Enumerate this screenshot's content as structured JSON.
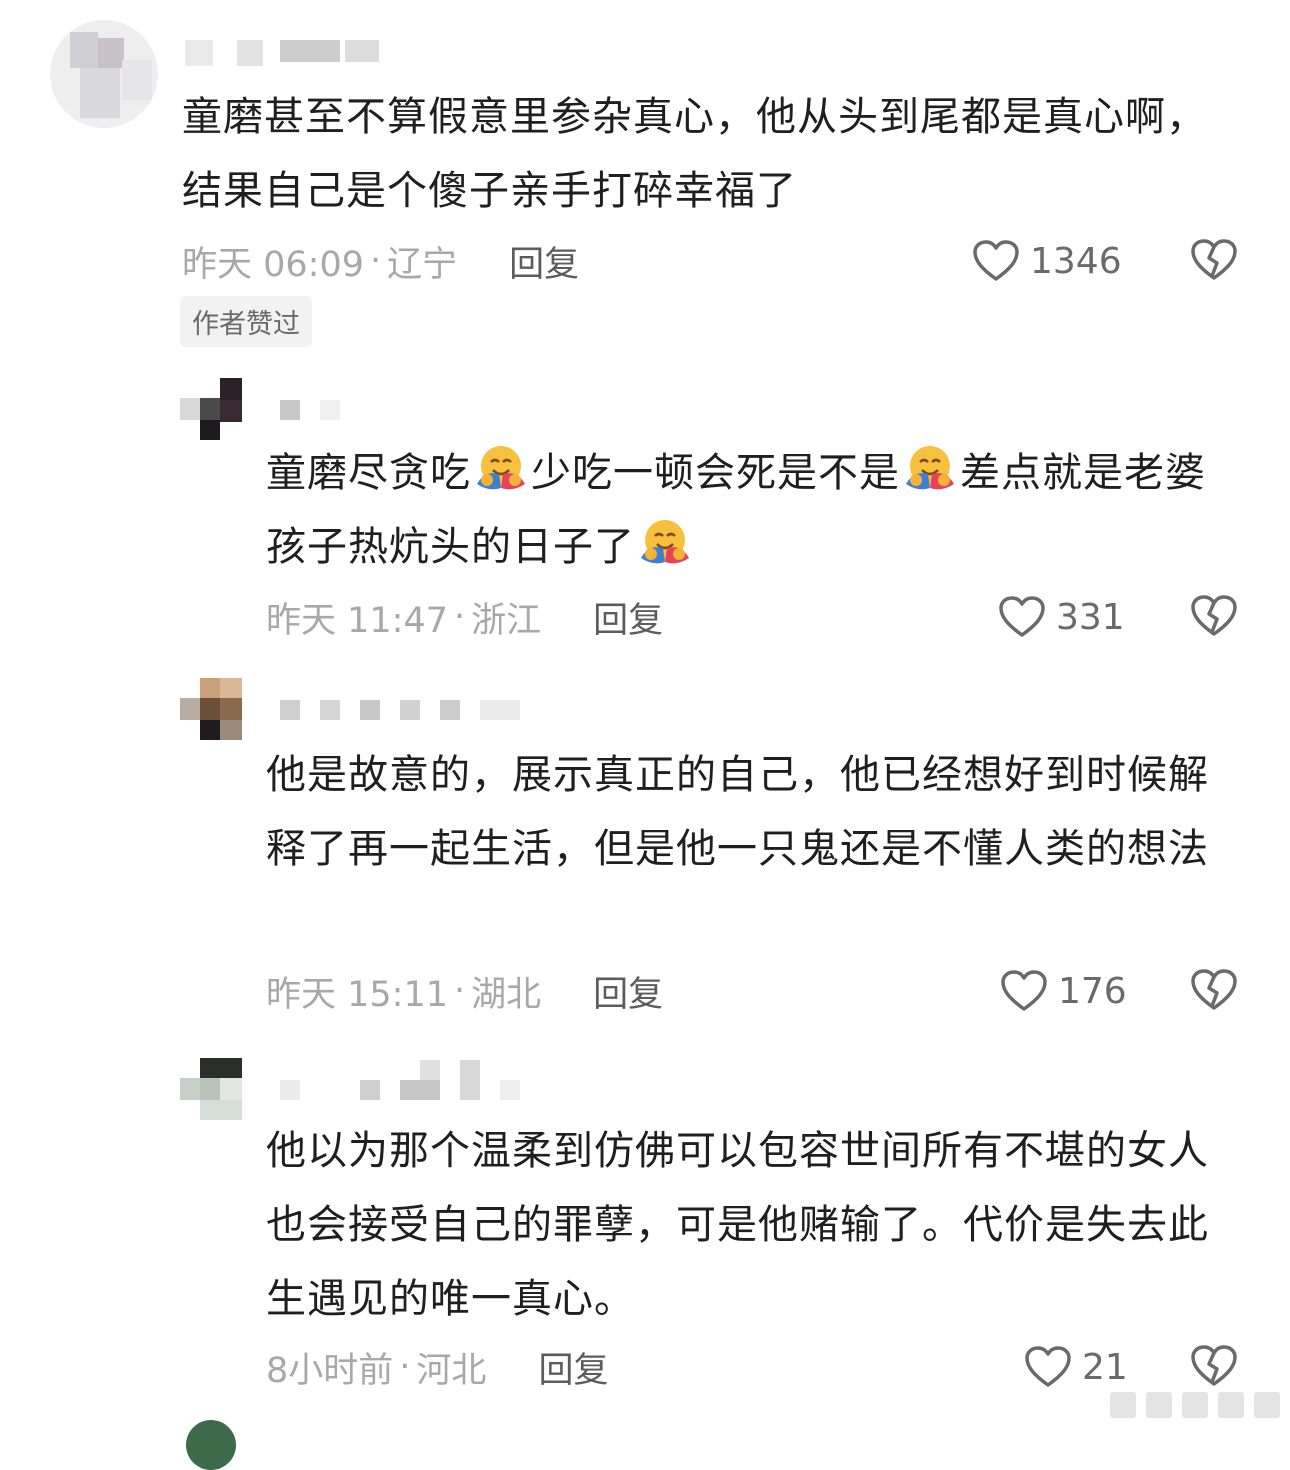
{
  "comments": [
    {
      "text": "童磨甚至不算假意里参杂真心，他从头到尾都是真心啊，结果自己是个傻子亲手打碎幸福了",
      "time": "昨天 06:09",
      "location": "辽宁",
      "reply_label": "回复",
      "likes": "1346",
      "badge": "作者赞过"
    },
    {
      "text_parts": [
        "童磨尽贪吃",
        "少吃一顿会死是不是",
        "差点就是老婆孩子热炕头的日子了"
      ],
      "emoji": "hugging-face-emoji",
      "time": "昨天 11:47",
      "location": "浙江",
      "reply_label": "回复",
      "likes": "331"
    },
    {
      "text": "他是故意的，展示真正的自己，他已经想好到时候解释了再一起生活，但是他一只鬼还是不懂人类的想法",
      "time": "昨天 15:11",
      "location": "湖北",
      "reply_label": "回复",
      "likes": "176"
    },
    {
      "text": "他以为那个温柔到仿佛可以包容世间所有不堪的女人也会接受自己的罪孽，可是他赌输了。代价是失去此生遇见的唯一真心。",
      "time": "8小时前",
      "location": "河北",
      "reply_label": "回复",
      "likes": "21"
    }
  ],
  "separator": "·",
  "icons": {
    "like": "heart-outline-icon",
    "dislike": "broken-heart-icon"
  }
}
